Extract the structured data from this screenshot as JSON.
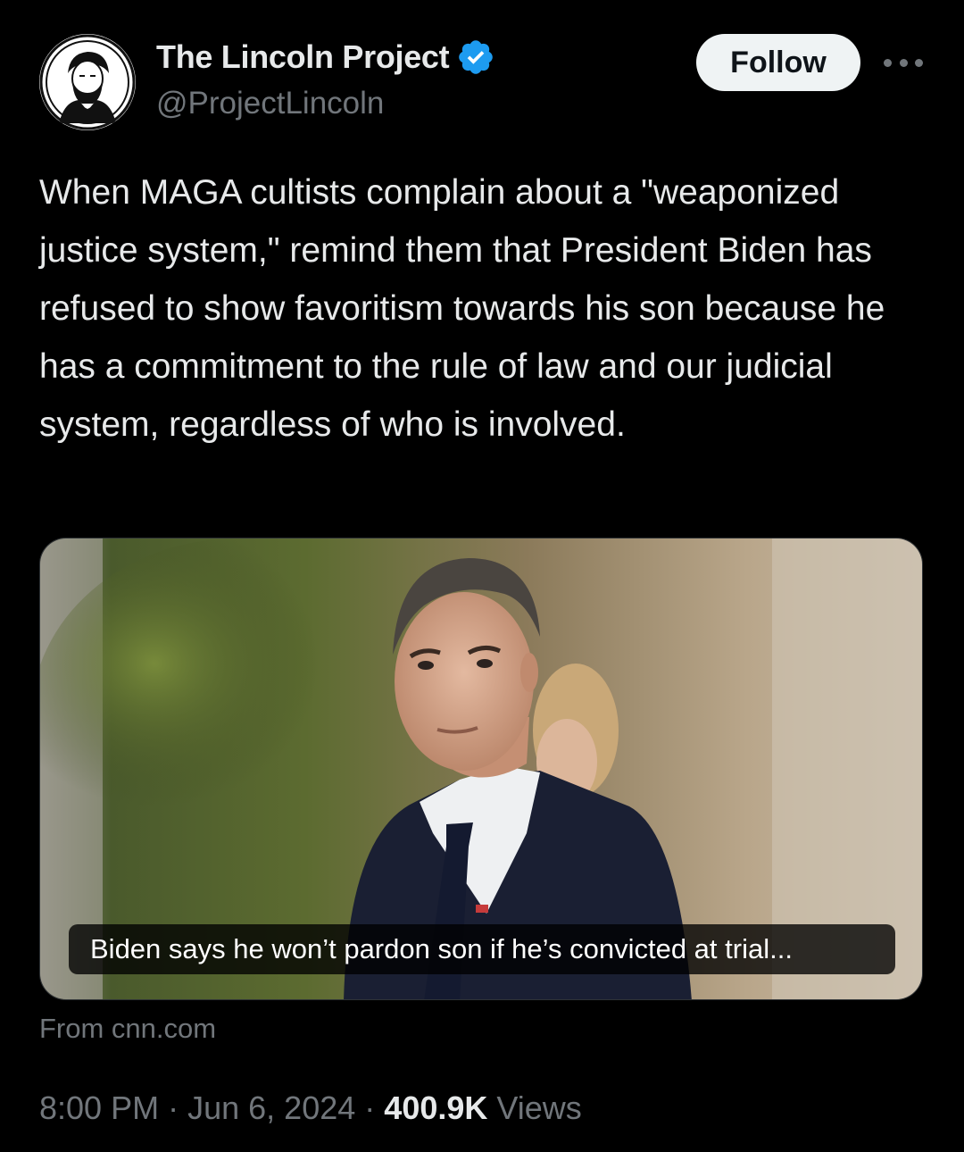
{
  "author": {
    "display_name": "The Lincoln Project",
    "handle": "@ProjectLincoln",
    "verified": true,
    "avatar_icon": "lincoln-portrait-icon"
  },
  "actions": {
    "follow_label": "Follow",
    "more_icon": "more-options-icon"
  },
  "tweet": {
    "text": "When MAGA cultists complain about a \"weaponized justice system,\" remind them that President Biden has refused to show favoritism towards his son because he has a commitment to the rule of law and our judicial system, regardless of who is involved."
  },
  "card": {
    "caption": "Biden says he won’t pardon son if he’s convicted at trial...",
    "source": "From cnn.com"
  },
  "meta": {
    "time": "8:00 PM",
    "separator": "·",
    "date": "Jun 6, 2024",
    "views_count": "400.9K",
    "views_label": "Views"
  },
  "colors": {
    "background": "#000000",
    "text": "#e7e9ea",
    "muted": "#71767b",
    "verified": "#1d9bf0",
    "follow_bg": "#eff3f4"
  }
}
